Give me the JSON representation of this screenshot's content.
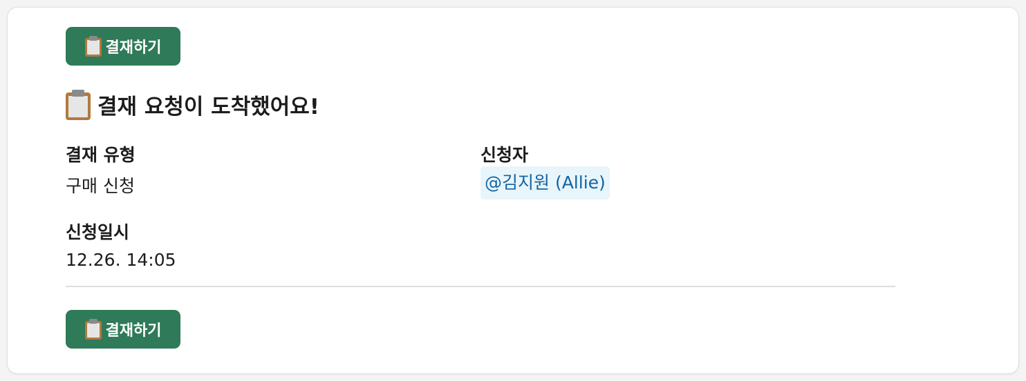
{
  "buttons": {
    "top_label": "결재하기",
    "bottom_label": "결재하기"
  },
  "heading": "결재 요청이 도착했어요!",
  "icons": {
    "clipboard": "clipboard-icon"
  },
  "fields": {
    "type": {
      "label": "결재 유형",
      "value": "구매 신청"
    },
    "applicant": {
      "label": "신청자",
      "value": "@김지원 (Allie)"
    },
    "date": {
      "label": "신청일시",
      "value": "12.26. 14:05"
    }
  },
  "colors": {
    "button": "#2f7a58",
    "mention_text": "#1264a3",
    "mention_bg": "#e8f5fa"
  }
}
